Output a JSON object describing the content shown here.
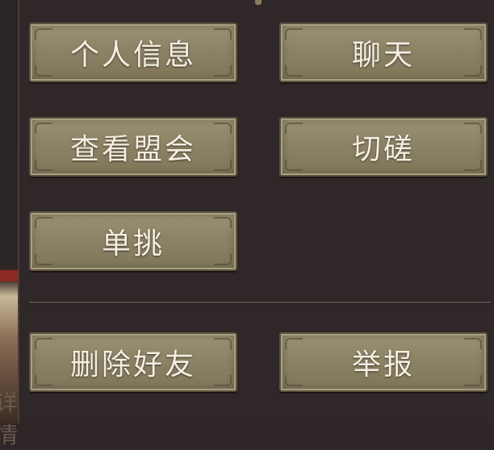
{
  "menu": {
    "profile_label": "个人信息",
    "chat_label": "聊天",
    "view_alliance_label": "查看盟会",
    "spar_label": "切磋",
    "duel_label": "单挑",
    "delete_friend_label": "删除好友",
    "report_label": "举报"
  },
  "background": {
    "partial_text": "详情"
  },
  "colors": {
    "panel_bg": "#2f2728",
    "button_face": "#8c8366",
    "button_text": "#f4efe2"
  }
}
